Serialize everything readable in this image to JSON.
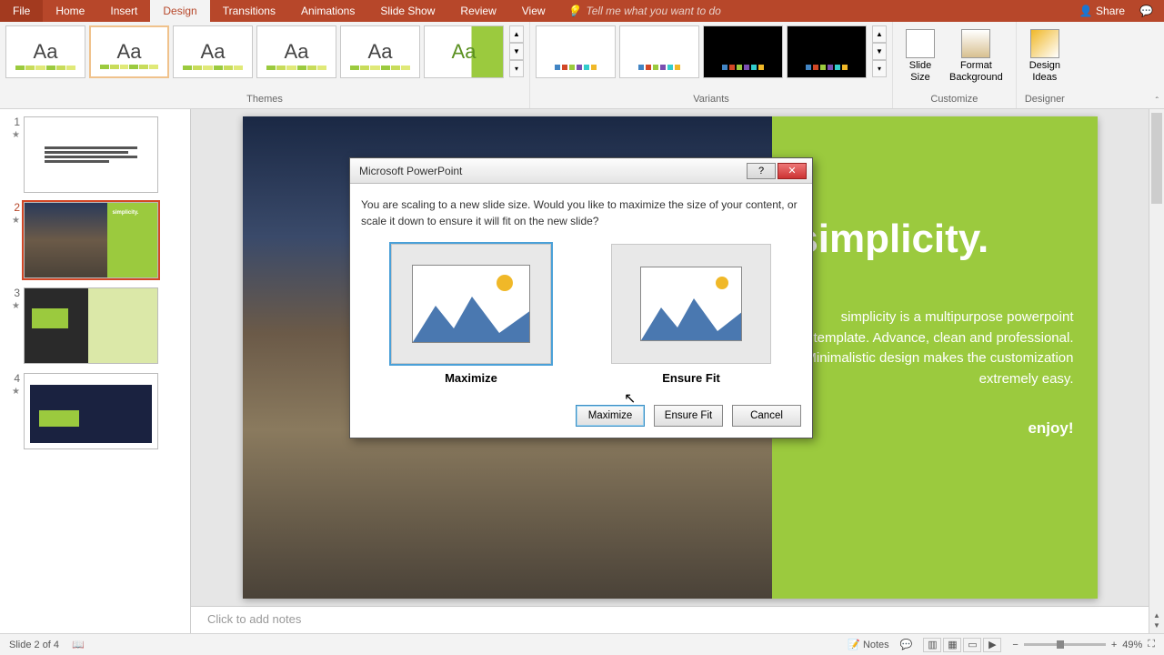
{
  "app": {
    "dialog_title": "Microsoft PowerPoint"
  },
  "tabs": {
    "file": "File",
    "home": "Home",
    "insert": "Insert",
    "design": "Design",
    "transitions": "Transitions",
    "animations": "Animations",
    "slideshow": "Slide Show",
    "review": "Review",
    "view": "View",
    "tell_me": "Tell me what you want to do",
    "share": "Share"
  },
  "ribbon": {
    "themes_label": "Themes",
    "variants_label": "Variants",
    "customize_label": "Customize",
    "designer_label": "Designer",
    "slide_size": "Slide\nSize",
    "format_bg": "Format\nBackground",
    "design_ideas": "Design\nIdeas"
  },
  "slides": {
    "n1": "1",
    "n2": "2",
    "n3": "3",
    "n4": "4"
  },
  "slide_content": {
    "title": "simplicity.",
    "body": "simplicity is a multipurpose powerpoint template. Advance, clean and professional. Minimalistic design makes the customization extremely easy.",
    "enjoy": "enjoy!"
  },
  "notes_placeholder": "Click to add notes",
  "status": {
    "slide_of": "Slide 2 of 4",
    "notes": "Notes",
    "zoom": "49%"
  },
  "dialog": {
    "msg": "You are scaling to a new slide size.  Would you like to maximize the size of your content, or scale it down to ensure it will fit on the new slide?",
    "opt_max": "Maximize",
    "opt_fit": "Ensure Fit",
    "btn_max": "Maximize",
    "btn_fit": "Ensure Fit",
    "btn_cancel": "Cancel",
    "help": "?",
    "close": "✕"
  }
}
